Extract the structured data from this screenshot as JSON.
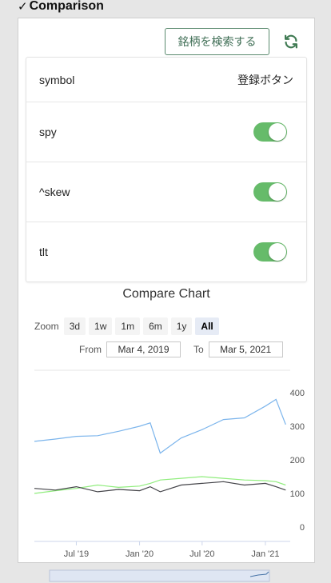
{
  "header": {
    "check": "✓",
    "title": "Comparison"
  },
  "toolbar": {
    "search_label": "銘柄を検索する"
  },
  "list": {
    "head": {
      "symbol": "symbol",
      "register": "登録ボタン"
    },
    "rows": [
      {
        "symbol": "spy",
        "enabled": true
      },
      {
        "symbol": "^skew",
        "enabled": true
      },
      {
        "symbol": "tlt",
        "enabled": true
      }
    ]
  },
  "chart": {
    "title": "Compare Chart",
    "zoom_label": "Zoom",
    "zoom_buttons": [
      "3d",
      "1w",
      "1m",
      "6m",
      "1y",
      "All"
    ],
    "zoom_active": "All",
    "from_label": "From",
    "from_value": "Mar 4, 2019",
    "to_label": "To",
    "to_value": "Mar 5, 2021"
  },
  "chart_data": {
    "type": "line",
    "x_ticks": [
      "Jul '19",
      "Jan '20",
      "Jul '20",
      "Jan '21"
    ],
    "y_ticks": [
      0,
      100,
      200,
      300,
      400
    ],
    "ylim": [
      0,
      400
    ],
    "series": [
      {
        "color": "#7cb5ec",
        "x": [
          "2019-03",
          "2019-05",
          "2019-07",
          "2019-09",
          "2019-11",
          "2020-01",
          "2020-02",
          "2020-03",
          "2020-05",
          "2020-07",
          "2020-09",
          "2020-11",
          "2021-01",
          "2021-02",
          "2021-03"
        ],
        "values": [
          255,
          262,
          270,
          272,
          285,
          300,
          310,
          220,
          265,
          290,
          320,
          325,
          360,
          380,
          305
        ]
      },
      {
        "color": "#90ed7d",
        "x": [
          "2019-03",
          "2019-05",
          "2019-07",
          "2019-09",
          "2019-11",
          "2020-01",
          "2020-02",
          "2020-03",
          "2020-05",
          "2020-07",
          "2020-09",
          "2020-11",
          "2021-01",
          "2021-02",
          "2021-03"
        ],
        "values": [
          100,
          108,
          115,
          125,
          118,
          122,
          130,
          140,
          145,
          150,
          145,
          140,
          138,
          135,
          125
        ]
      },
      {
        "color": "#434348",
        "x": [
          "2019-03",
          "2019-05",
          "2019-07",
          "2019-09",
          "2019-11",
          "2020-01",
          "2020-02",
          "2020-03",
          "2020-05",
          "2020-07",
          "2020-09",
          "2020-11",
          "2021-01",
          "2021-02",
          "2021-03"
        ],
        "values": [
          115,
          110,
          120,
          105,
          112,
          108,
          120,
          105,
          125,
          130,
          135,
          125,
          130,
          120,
          110
        ]
      }
    ]
  }
}
